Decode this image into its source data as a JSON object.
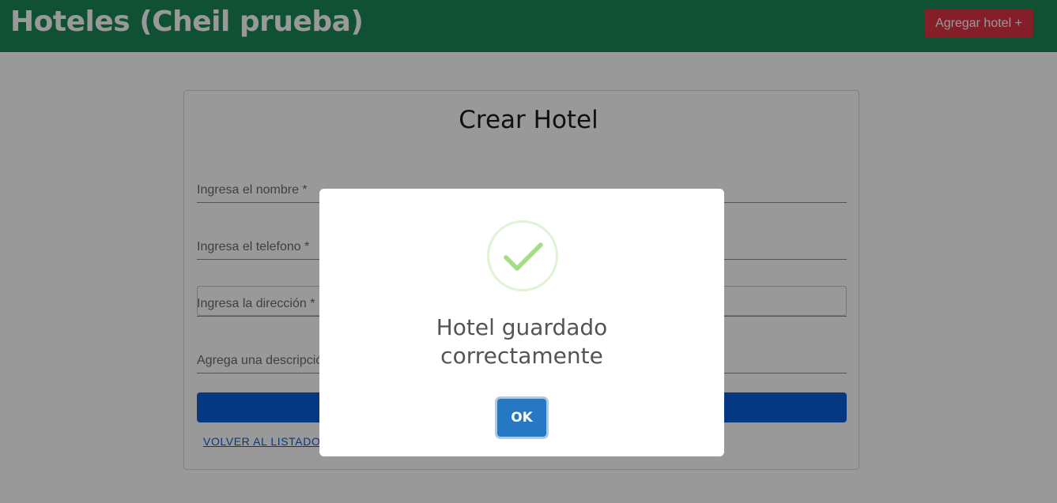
{
  "header": {
    "title": "Hoteles (Cheil prueba)",
    "add_button_label": "Agregar hotel +"
  },
  "form": {
    "title": "Crear Hotel",
    "fields": [
      {
        "label": "Ingresa el nombre *"
      },
      {
        "label": "Ingresa el telefono *"
      },
      {
        "label": "Ingresa la dirección *"
      },
      {
        "label": "Agrega una descripció"
      }
    ],
    "back_link_label": "VOLVER AL LISTADO D"
  },
  "modal": {
    "icon": "success-check-icon",
    "title_line1": "Hotel guardado",
    "title_line2": "correctamente",
    "ok_label": "OK"
  },
  "colors": {
    "navbar": "#198754",
    "danger": "#dc3545",
    "primary": "#0b5ed7",
    "success_check": "#a5dc86",
    "confirm": "#2778c4"
  }
}
